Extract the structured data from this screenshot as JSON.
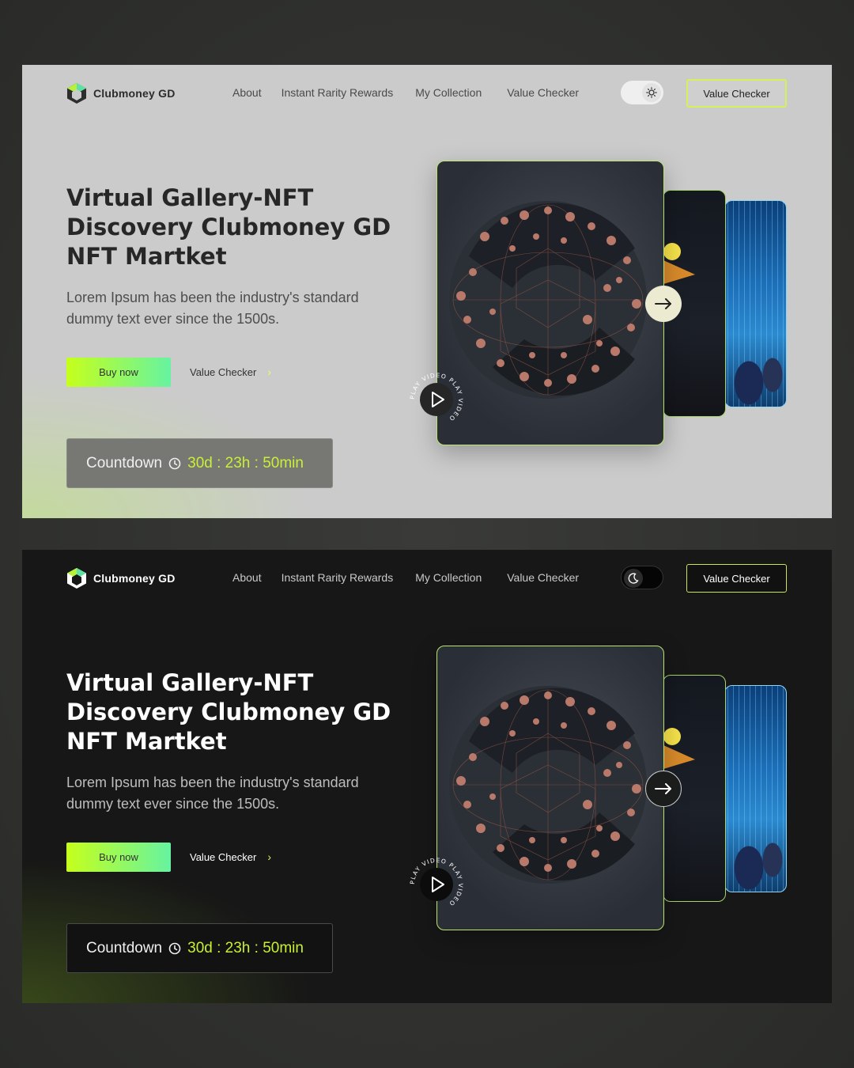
{
  "brand": {
    "name": "Clubmoney GD",
    "accent_green": "#c6ff1b",
    "accent_mint": "#66f3a1"
  },
  "nav": {
    "items": [
      {
        "label": "About"
      },
      {
        "label": "Instant Rarity Rewards"
      },
      {
        "label": "My Collection"
      },
      {
        "label": "Value Checker"
      }
    ],
    "cta_label": "Value Checker"
  },
  "hero": {
    "headline_lines": [
      "Virtual Gallery-NFT",
      "Discovery Clubmoney GD",
      "NFT Martket"
    ],
    "subtext_lines": [
      "Lorem Ipsum has been the industry's standard",
      "dummy text ever since the 1500s."
    ],
    "buy_label": "Buy now",
    "secondary_label": "Value Checker",
    "countdown_label": "Countdown",
    "countdown_value": "30d : 23h : 50min",
    "play_text": "PLAY VIDEO PLAY VIDEO"
  },
  "themes": {
    "light": {
      "toggle_icon": "sun-icon",
      "background": "#cbcbcb"
    },
    "dark": {
      "toggle_icon": "moon-icon",
      "background": "#171717"
    }
  }
}
